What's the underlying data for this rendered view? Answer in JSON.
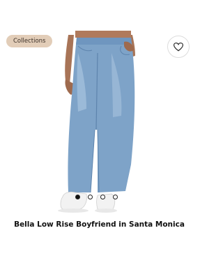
{
  "badge": {
    "label": "Collections"
  },
  "favorite": {
    "icon": "heart-icon"
  },
  "carousel": {
    "count": 4,
    "active_index": 0
  },
  "product": {
    "title": "Bella Low Rise Boyfriend in Santa Monica"
  },
  "colors": {
    "badge_bg": "#e2cdb8",
    "denim": "#7ea3c8",
    "text": "#111111"
  }
}
